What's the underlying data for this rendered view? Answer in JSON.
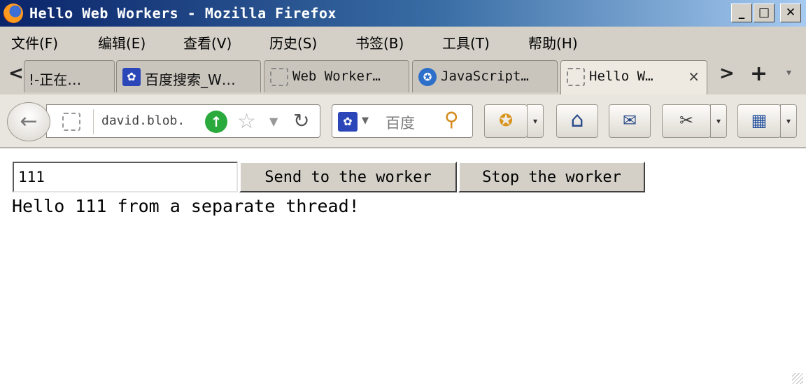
{
  "window": {
    "title": "Hello Web Workers - Mozilla Firefox"
  },
  "title_buttons": {
    "minimize": "_",
    "maximize": "□",
    "close": "✕"
  },
  "menu": [
    "文件(F)",
    "编辑(E)",
    "查看(V)",
    "历史(S)",
    "书签(B)",
    "工具(T)",
    "帮助(H)"
  ],
  "tabs": [
    {
      "label": "!-正在…",
      "icon": "none"
    },
    {
      "label": "百度搜索_W…",
      "icon": "baidu-paw-icon"
    },
    {
      "label": "Web Worker…",
      "icon": "blank-page-icon"
    },
    {
      "label": "JavaScript…",
      "icon": "javascript-site-icon"
    },
    {
      "label": "Hello W…",
      "icon": "blank-page-icon",
      "active": true
    }
  ],
  "tab_controls": {
    "scroll_left": "<",
    "scroll_right": ">",
    "new_tab": "+",
    "list": "▾",
    "close": "×"
  },
  "nav": {
    "url": "david.blob.",
    "search_placeholder": "百度"
  },
  "glyphs": {
    "back": "←",
    "go": "↑",
    "star": "☆",
    "dropdown": "▼",
    "reload": "↻",
    "paw": "✿",
    "magnifier": "⚲",
    "home": "⌂",
    "mail": "✉",
    "screenshot": "✂",
    "apps": "▦",
    "addon": "✪",
    "small_dd": "▾"
  },
  "content": {
    "input_value": "111",
    "send_label": "Send to the worker",
    "stop_label": "Stop the worker",
    "output_text": "Hello 111 from a separate thread!"
  }
}
